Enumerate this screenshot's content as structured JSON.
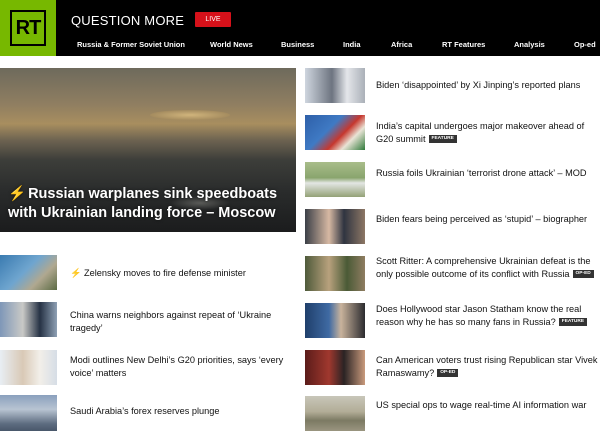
{
  "header": {
    "logo": "RT",
    "tagline": "QUESTION MORE",
    "live": "LIVE",
    "nav": [
      "Russia & Former Soviet Union",
      "World News",
      "Business",
      "India",
      "Africa",
      "RT Features",
      "Analysis",
      "Op-ed"
    ]
  },
  "hero": {
    "title": "Russian warplanes sink speedboats with Ukrainian landing force – Moscow"
  },
  "left_list": [
    {
      "title": "Zelensky moves to fire defense minister",
      "urgent": true
    },
    {
      "title": "China warns neighbors against repeat of ‘Ukraine tragedy’"
    },
    {
      "title": "Modi outlines New Delhi’s G20 priorities, says ‘every voice’ matters"
    },
    {
      "title": "Saudi Arabia’s forex reserves plunge"
    }
  ],
  "right_list": [
    {
      "title": "Biden ‘disappointed’ by Xi Jinping’s reported plans"
    },
    {
      "title": "India’s capital undergoes major makeover ahead of G20 summit",
      "badge": "FEATURE"
    },
    {
      "title": "Russia foils Ukrainian ‘terrorist drone attack’ – MOD"
    },
    {
      "title": "Biden fears being perceived as ‘stupid’ – biographer"
    },
    {
      "title": "Scott Ritter: A comprehensive Ukrainian defeat is the only possible outcome of its conflict with Russia",
      "badge": "OP-ED"
    },
    {
      "title": "Does Hollywood star Jason Statham know the real reason why he has so many fans in Russia?",
      "badge": "FEATURE"
    },
    {
      "title": "Can American voters trust rising Republican star Vivek Ramaswamy?",
      "badge": "OP-ED"
    },
    {
      "title": "US special ops to wage real-time AI information war"
    }
  ],
  "icons": {
    "urgent": "lightning-bolt-icon"
  },
  "colors": {
    "brand_green": "#77b800",
    "live_red": "#d6111a",
    "bolt_red": "#e1251b",
    "header_bg": "#000000"
  }
}
